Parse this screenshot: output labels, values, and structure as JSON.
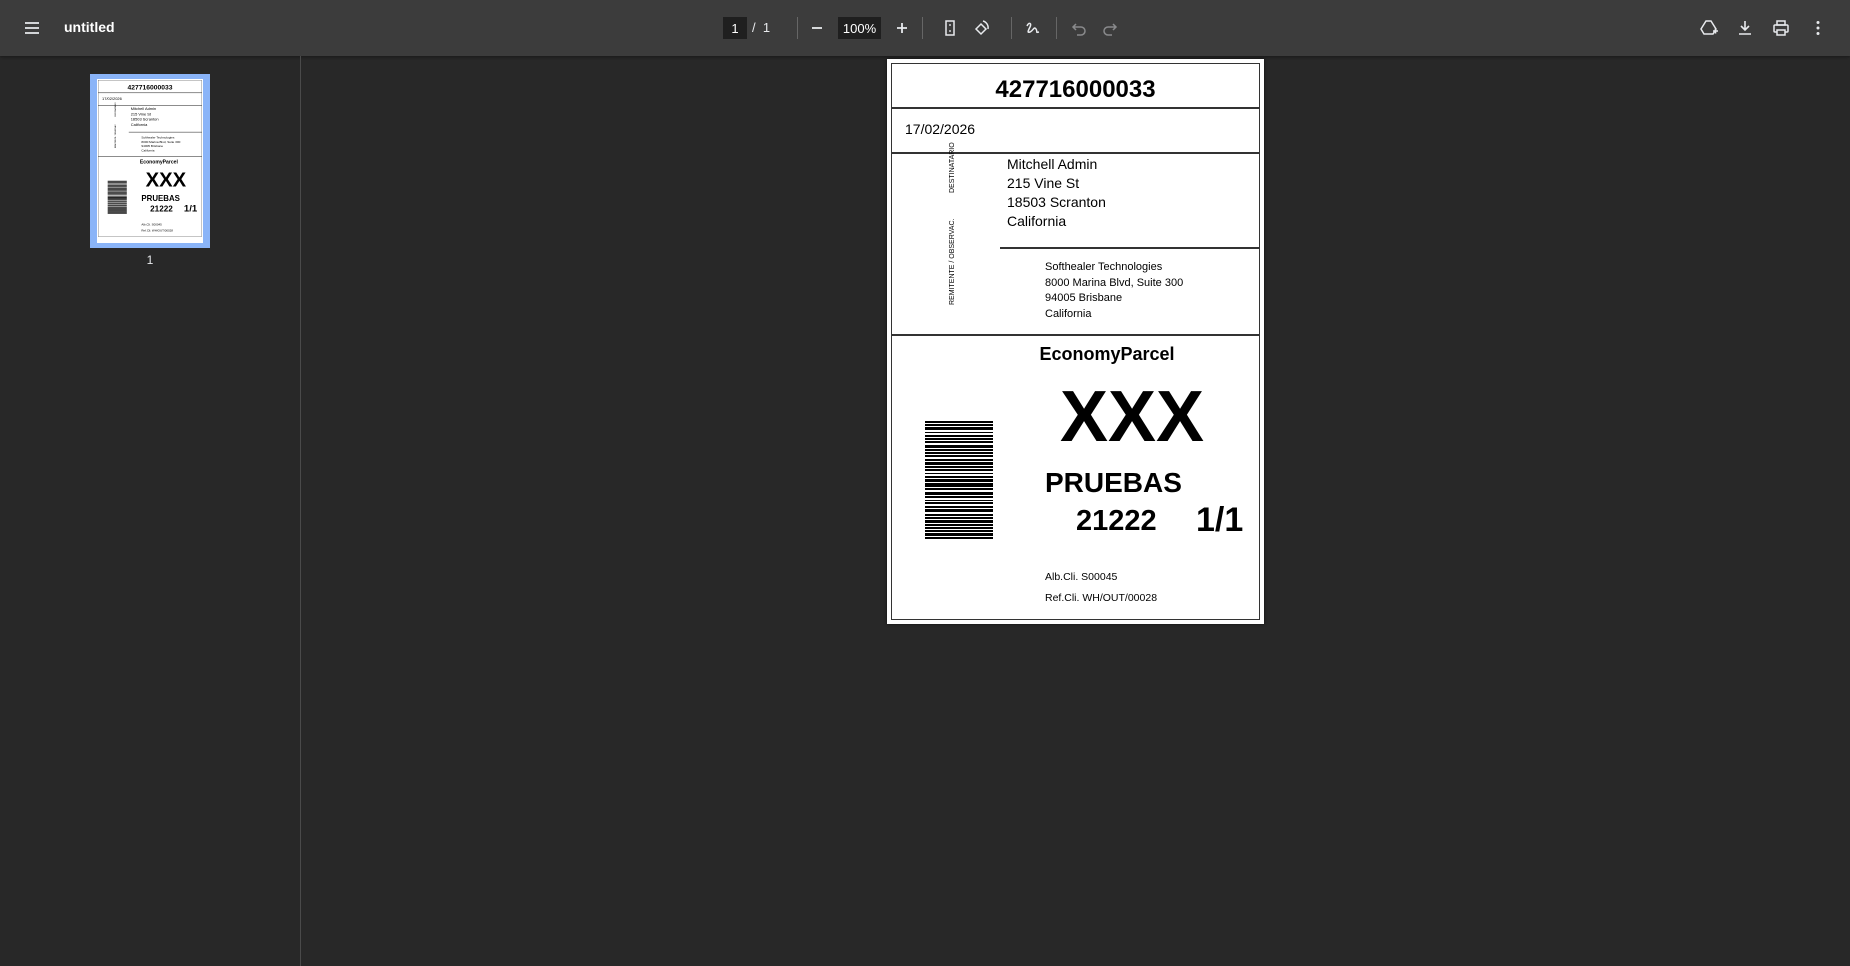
{
  "toolbar": {
    "title": "untitled",
    "current_page": "1",
    "page_sep": "/",
    "total_pages": "1",
    "zoom": "100%"
  },
  "sidebar": {
    "thumbnail_page_number": "1"
  },
  "label": {
    "tracking_number": "427716000033",
    "date": "17/02/2026",
    "recipient_heading": "DESTINATARIO",
    "sender_heading": "REMITENTE / OBSERVAC.",
    "recipient": [
      "Mitchell Admin",
      "215 Vine St",
      "18503 Scranton",
      "California"
    ],
    "sender": [
      "Softhealer Technologies",
      "8000 Marina Blvd, Suite 300",
      "94005 Brisbane",
      "California"
    ],
    "service": "EconomyParcel",
    "route_code": "XXX",
    "destination": "PRUEBAS",
    "postal_code": "21222",
    "package_count": "1/1",
    "alb_cli": "Alb.Cli. S00045",
    "ref_cli": "Ref.Cli. WH/OUT/00028"
  }
}
